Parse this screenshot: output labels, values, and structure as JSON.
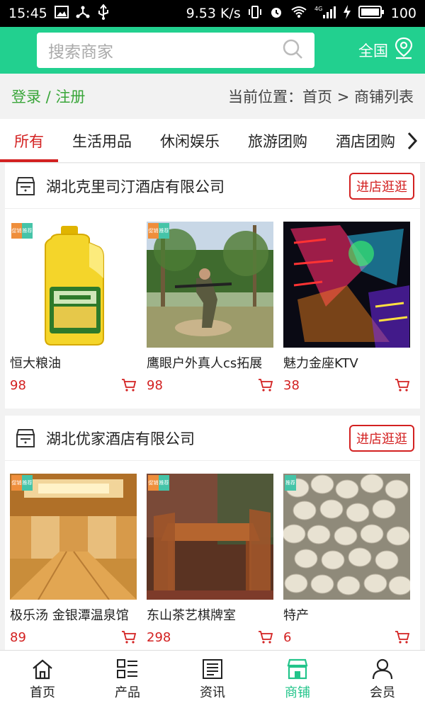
{
  "status": {
    "time": "15:45",
    "speed": "9.53 K/s",
    "battery": "100",
    "network": "4G"
  },
  "header": {
    "search_placeholder": "搜索商家",
    "location_label": "全国"
  },
  "crumb": {
    "login": "登录 / 注册",
    "breadcrumb": "当前位置：首页 > 商铺列表"
  },
  "tabs": [
    "所有",
    "生活用品",
    "休闲娱乐",
    "旅游团购",
    "酒店团购"
  ],
  "shops": [
    {
      "name": "湖北克里司汀酒店有限公司",
      "enter_label": "进店逛逛",
      "products": [
        {
          "name": "恒大粮油",
          "price": "98"
        },
        {
          "name": "鹰眼户外真人cs拓展",
          "price": "98"
        },
        {
          "name": "魅力金座KTV",
          "price": "38"
        }
      ]
    },
    {
      "name": "湖北优家酒店有限公司",
      "enter_label": "进店逛逛",
      "products": [
        {
          "name": "极乐汤 金银潭温泉馆",
          "price": "89"
        },
        {
          "name": "东山茶艺棋牌室",
          "price": "298"
        },
        {
          "name": "特产",
          "price": "6"
        }
      ]
    }
  ],
  "badge": {
    "left": "促销",
    "right": "推荐"
  },
  "bottom_nav": [
    {
      "label": "首页",
      "icon": "home-icon"
    },
    {
      "label": "产品",
      "icon": "grid-list-icon"
    },
    {
      "label": "资讯",
      "icon": "news-icon"
    },
    {
      "label": "商铺",
      "icon": "store-icon"
    },
    {
      "label": "会员",
      "icon": "user-icon"
    }
  ],
  "colors": {
    "accent": "#22d08f",
    "price": "#d32121",
    "login": "#3aa63a",
    "nav_active": "#22c48a"
  }
}
